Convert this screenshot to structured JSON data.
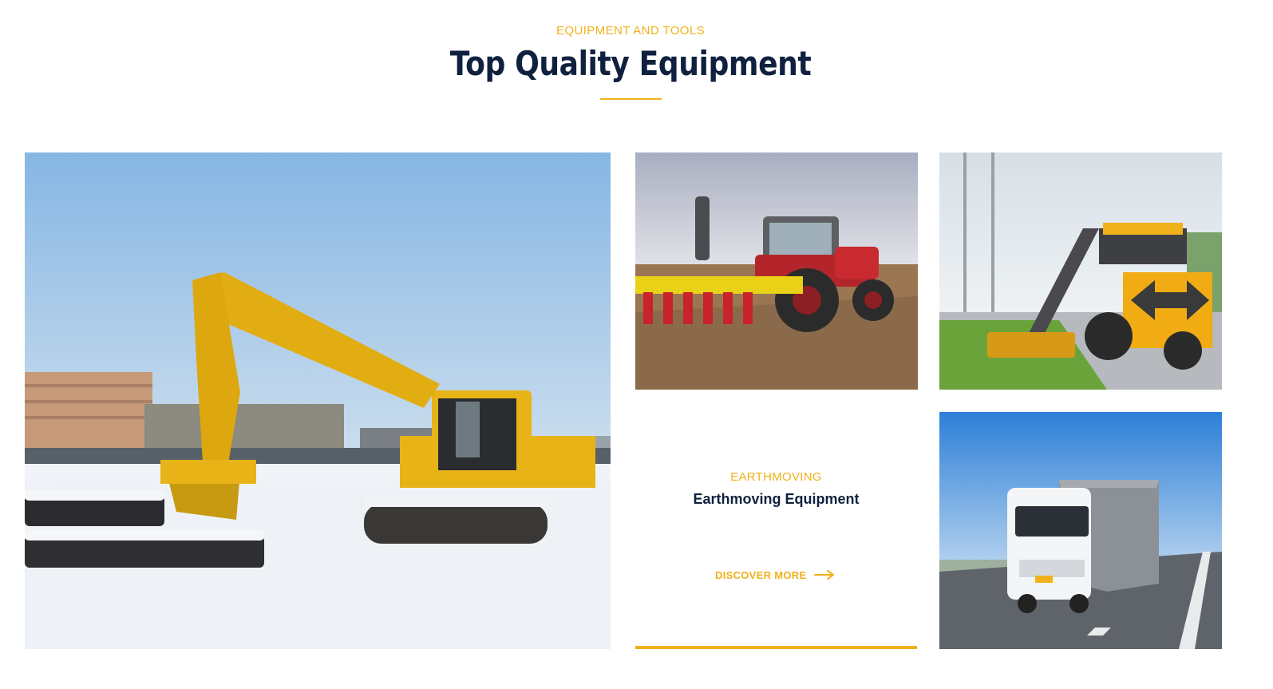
{
  "header": {
    "eyebrow": "EQUIPMENT AND TOOLS",
    "title": "Top Quality Equipment"
  },
  "tiles": [
    {
      "name": "excavator",
      "icon": "excavator-photo"
    },
    {
      "name": "tractor",
      "icon": "tractor-seeder-photo"
    },
    {
      "name": "mower",
      "icon": "roadside-mower-tractor-photo"
    },
    {
      "name": "truck",
      "icon": "container-truck-photo"
    }
  ],
  "card": {
    "category": "EARTHMOVING",
    "title": "Earthmoving Equipment",
    "link_label": "DISCOVER MORE",
    "link_icon": "arrow-right-icon"
  },
  "colors": {
    "accent": "#f0b21a",
    "heading": "#0f213f"
  }
}
